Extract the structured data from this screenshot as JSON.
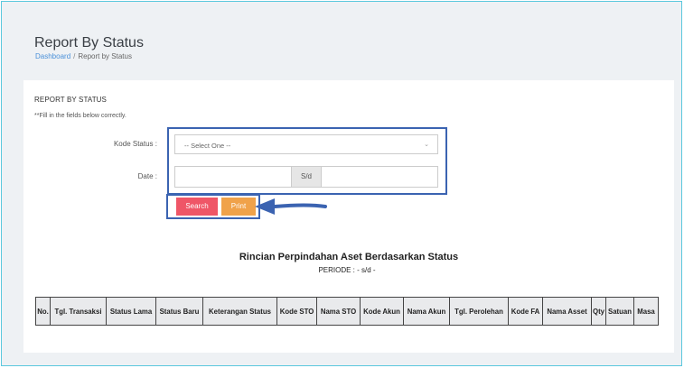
{
  "header": {
    "title": "Report By Status",
    "breadcrumb": {
      "home": "Dashboard",
      "separator": "/",
      "current": "Report by Status"
    }
  },
  "form": {
    "title": "REPORT BY STATUS",
    "hint": "**Fill in the fields below correctly.",
    "kode_status_label": "Kode Status :",
    "kode_status_value": "-- Select One --",
    "date_label": "Date :",
    "date_separator": "S/d",
    "search_label": "Search",
    "print_label": "Print"
  },
  "report": {
    "title": "Rincian Perpindahan Aset Berdasarkan Status",
    "period": "PERIODE : - s/d -",
    "columns": [
      "No.",
      "Tgl. Transaksi",
      "Status Lama",
      "Status Baru",
      "Keterangan Status",
      "Kode STO",
      "Nama STO",
      "Kode Akun",
      "Nama Akun",
      "Tgl. Perolehan",
      "Kode FA",
      "Nama Asset",
      "Qty",
      "Satuan",
      "Masa"
    ]
  },
  "colors": {
    "search": "#ef5667",
    "print": "#f0a24a",
    "highlight": "#3b63b1",
    "link": "#4a90d9"
  }
}
